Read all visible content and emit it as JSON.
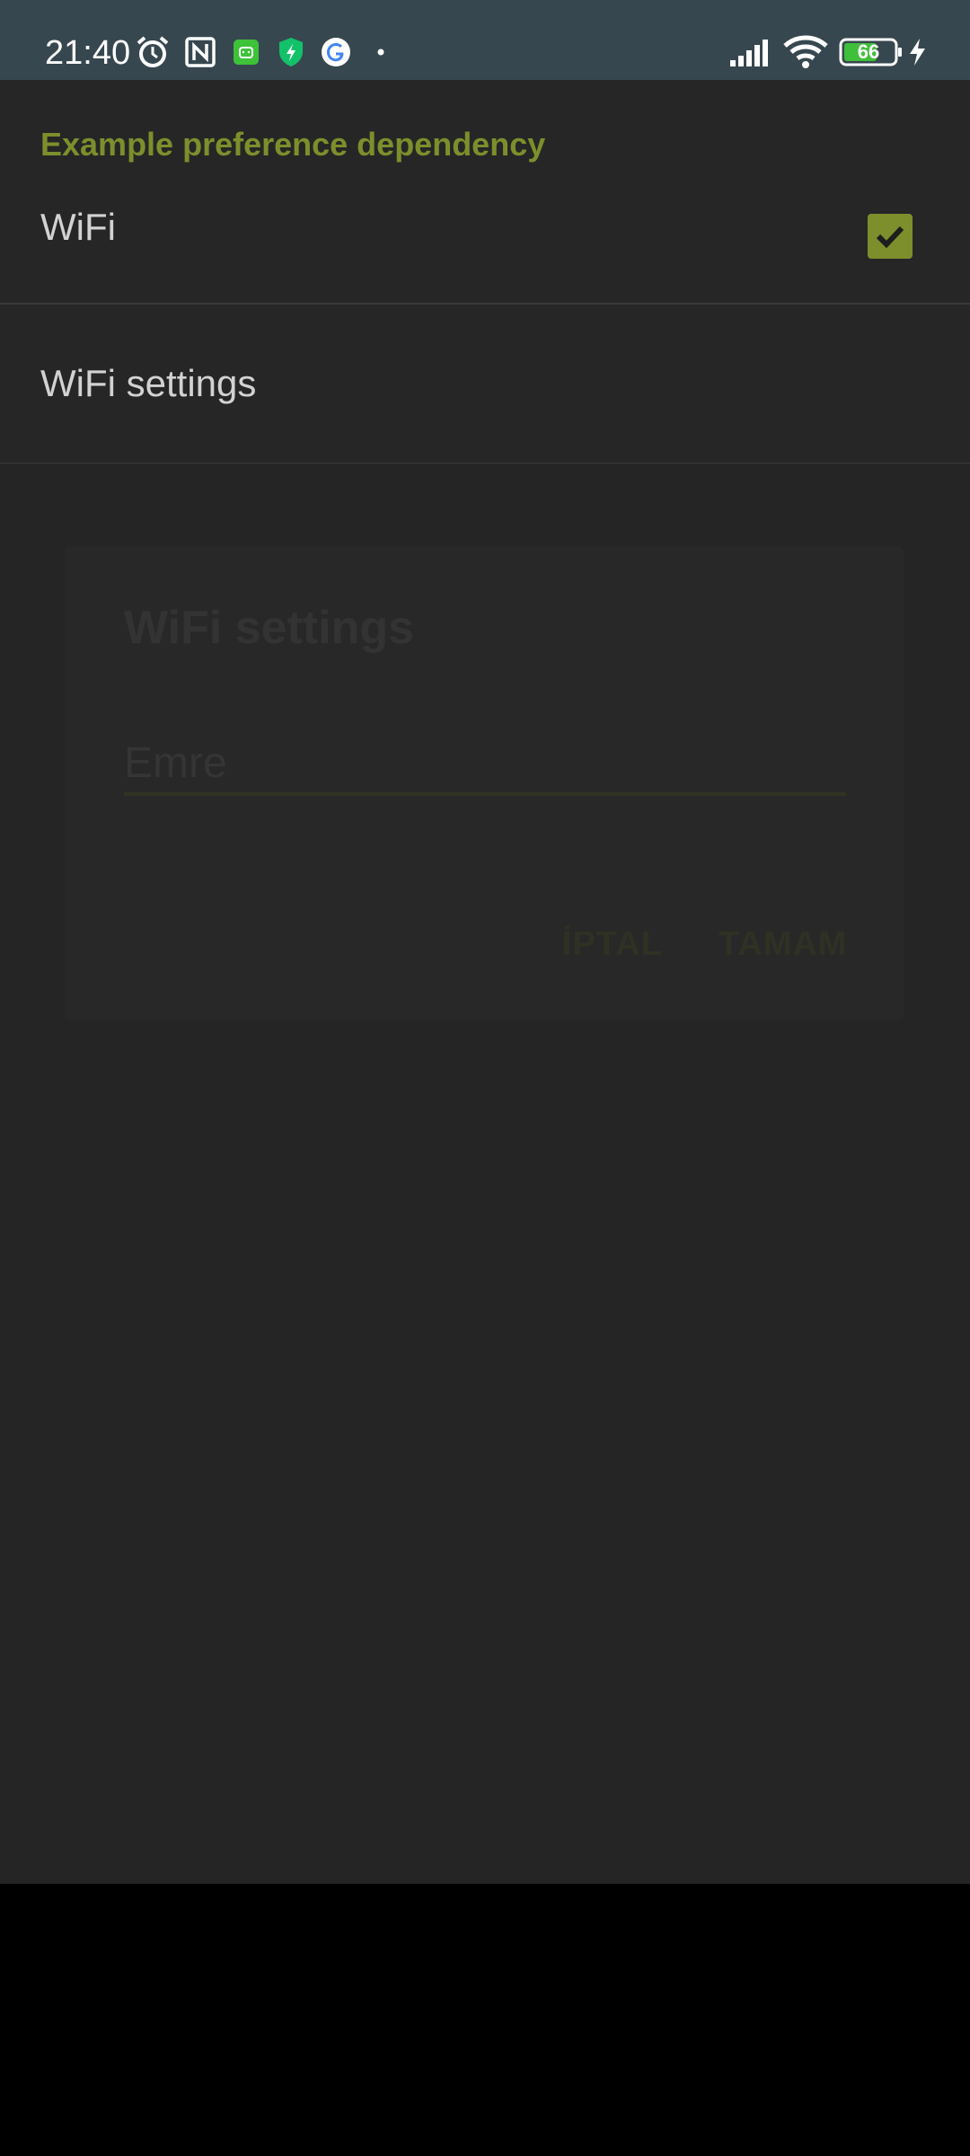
{
  "status_bar": {
    "time": "21:40",
    "battery_level": "66",
    "icons": [
      "alarm-icon",
      "nfc-icon",
      "android-app-icon",
      "shield-bolt-icon",
      "google-icon",
      "dot-icon",
      "signal-icon",
      "wifi-icon",
      "battery-icon",
      "charging-icon"
    ],
    "background_color": "#37474f"
  },
  "preferences": {
    "category_title": "Example preference dependency",
    "wifi": {
      "label": "WiFi",
      "checked": true
    },
    "wifi_settings": {
      "label": "WiFi settings"
    },
    "accent_color": "#7c8f2c"
  },
  "dialog": {
    "title": "WiFi settings",
    "input_value": "Emre",
    "cancel_label": "İPTAL",
    "ok_label": "TAMAM"
  }
}
